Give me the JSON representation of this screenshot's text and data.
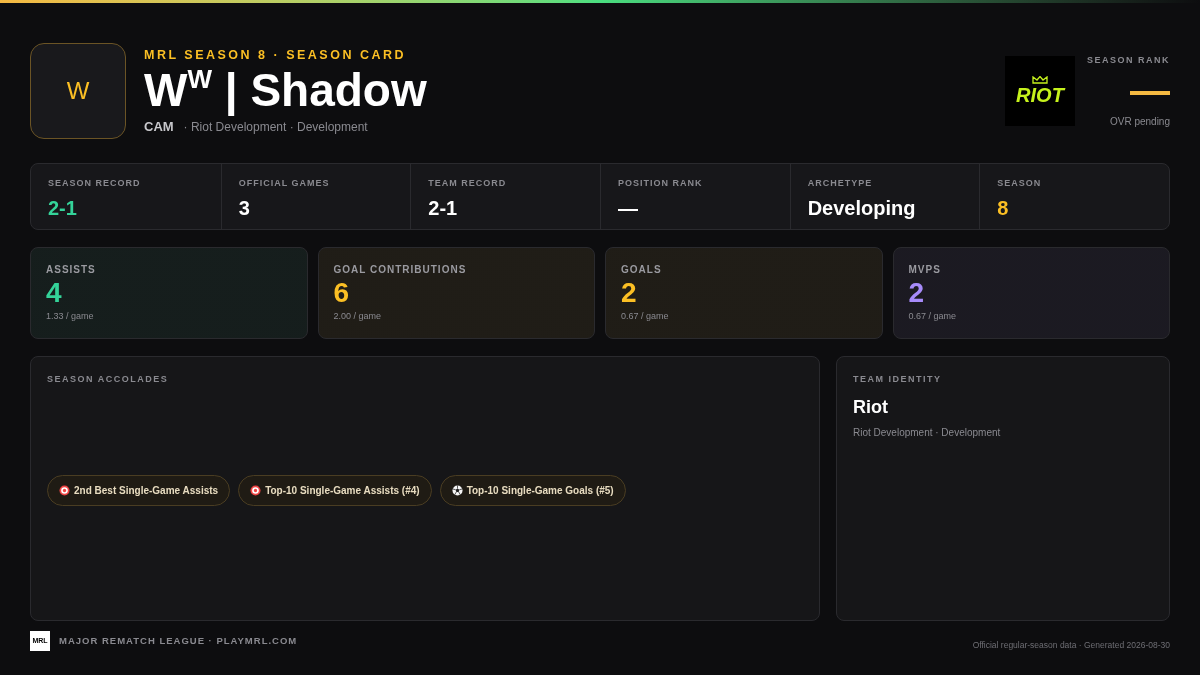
{
  "header": {
    "avatar_letter": "W",
    "eyebrow": "MRL SEASON 8 · SEASON CARD",
    "name": "W$^{W}$ | Shadow",
    "position": "CAM",
    "team_line": "· Riot Development · Development",
    "team_logo_text": "RIOT",
    "rank_label": "SEASON RANK",
    "rank_value": "—",
    "rank_note": "OVR pending"
  },
  "summary": [
    {
      "label": "SEASON RECORD",
      "value": "2-1",
      "color": "#34d399"
    },
    {
      "label": "OFFICIAL GAMES",
      "value": "3",
      "color": "#ffffff"
    },
    {
      "label": "TEAM RECORD",
      "value": "2-1",
      "color": "#ffffff"
    },
    {
      "label": "POSITION RANK",
      "value": "—",
      "color": "#ffffff"
    },
    {
      "label": "ARCHETYPE",
      "value": "Developing",
      "color": "#ffffff"
    },
    {
      "label": "SEASON",
      "value": "8",
      "color": "#fbbf24"
    }
  ],
  "stats": [
    {
      "label": "ASSISTS",
      "value": "4",
      "per_game": "1.33 / game",
      "color": "#34d399"
    },
    {
      "label": "GOAL CONTRIBUTIONS",
      "value": "6",
      "per_game": "2.00 / game",
      "color": "#fbbf24"
    },
    {
      "label": "GOALS",
      "value": "2",
      "per_game": "0.67 / game",
      "color": "#fbbf24"
    },
    {
      "label": "MVPS",
      "value": "2",
      "per_game": "0.67 / game",
      "color": "#a78bfa"
    }
  ],
  "accolades": {
    "title": "SEASON ACCOLADES",
    "items": [
      {
        "kind": "target",
        "label": "2nd Best Single-Game Assists"
      },
      {
        "kind": "target",
        "label": "Top-10 Single-Game Assists (#4)"
      },
      {
        "kind": "ball",
        "label": "Top-10 Single-Game Goals (#5)"
      }
    ]
  },
  "team_identity": {
    "title": "TEAM IDENTITY",
    "name": "Riot",
    "subtitle": "Riot Development · Development"
  },
  "footer": {
    "logo_text": "MRL",
    "league": "MAJOR REMATCH LEAGUE · PLAYMRL.COM",
    "note": "Official regular-season data · Generated 2026-08-30"
  }
}
